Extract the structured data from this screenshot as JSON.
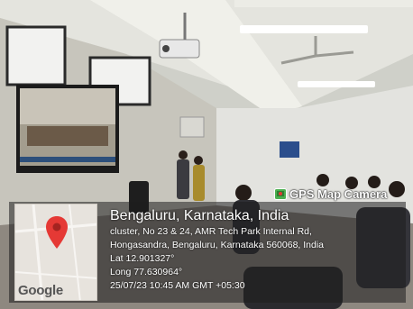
{
  "stamp": {
    "app_label": "GPS Map Camera",
    "map_brand": "Google",
    "location_title": "Bengaluru, Karnataka, India",
    "address_line1": "cluster, No 23 & 24, AMR Tech Park Internal Rd,",
    "address_line2": "Hongasandra, Bengaluru, Karnataka 560068, India",
    "latitude": "Lat 12.901327°",
    "longitude": "Long 77.630964°",
    "datetime": "25/07/23 10:45 AM GMT +05:30",
    "pin_color": "#e53935"
  }
}
